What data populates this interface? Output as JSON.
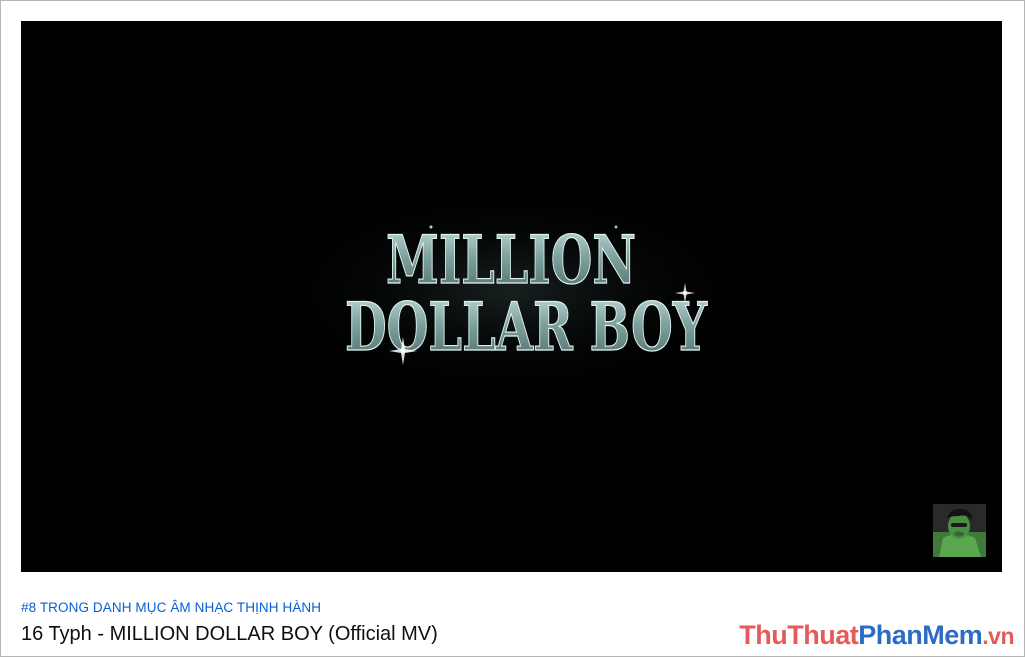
{
  "video": {
    "title_card": {
      "line1": "MILLION",
      "line2": "DOLLAR BOY"
    },
    "watermark_icon": "channel-avatar-icon",
    "trending_badge": "#8 TRONG DANH MỤC ÂM NHẠC THỊNH HÀNH",
    "title": "16 Typh - MILLION DOLLAR BOY (Official MV)"
  },
  "site_watermark": {
    "part1": "ThuThuat",
    "part2": "PhanMem",
    "part3": ".vn"
  },
  "colors": {
    "trending_link": "#065fd4",
    "title_text": "#0f0f0f",
    "player_bg": "#000000",
    "title_art": "#8fb3b0"
  }
}
